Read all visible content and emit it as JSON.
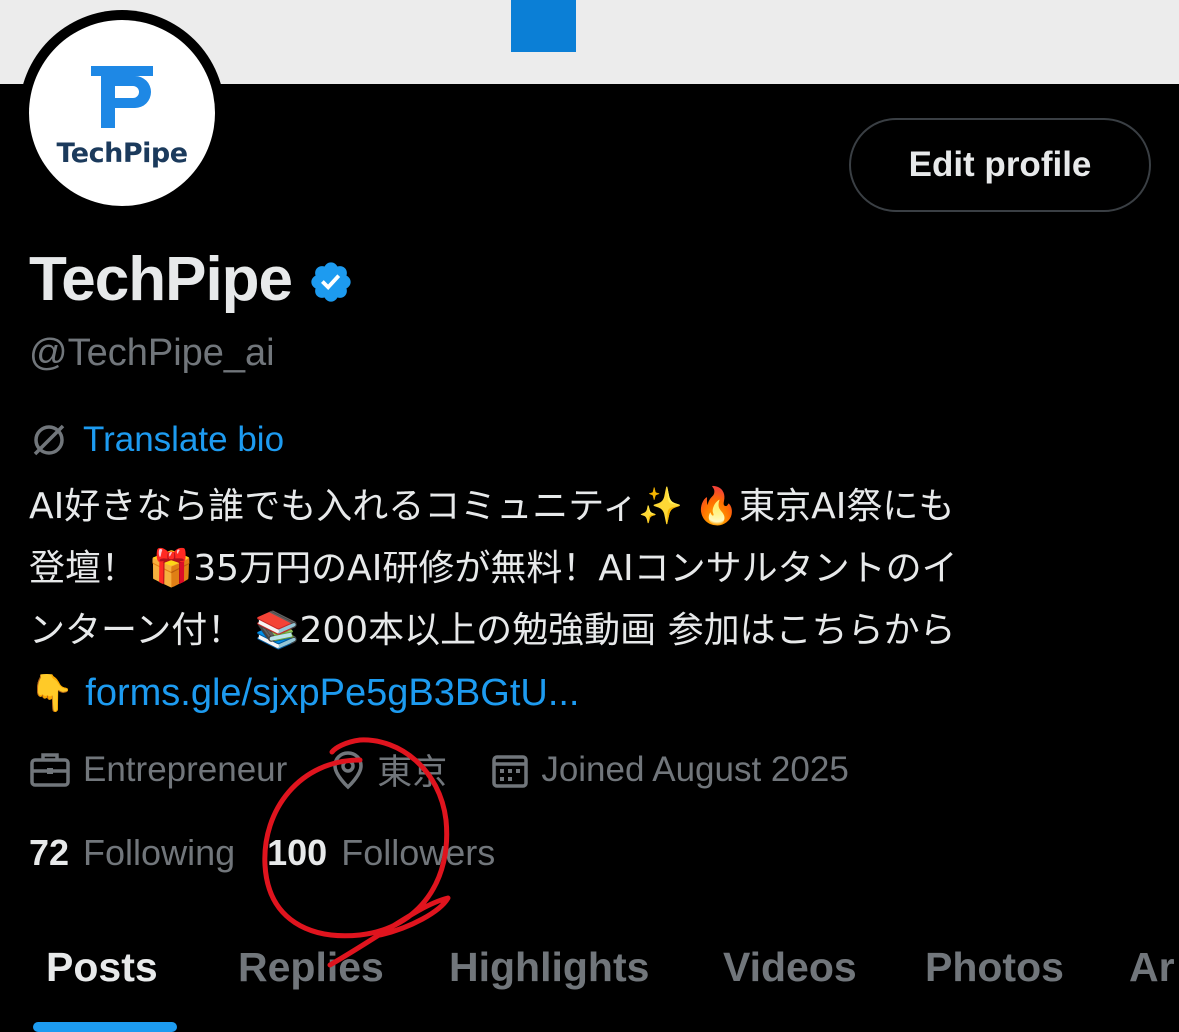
{
  "profile": {
    "avatar_text": "TechPipe",
    "name": "TechPipe",
    "handle": "@TechPipe_ai",
    "edit_label": "Edit profile",
    "translate_label": "Translate bio",
    "bio_lines": [
      "AI好きなら誰でも入れるコミュニティ✨ 🔥東京AI祭にも",
      "登壇！ 🎁35万円のAI研修が無料！AIコンサルタントのイ",
      "ンターン付！ 📚200本以上の勉強動画 参加はこちらから"
    ],
    "bio_pointer": "👇",
    "bio_link": "forms.gle/sjxpPe5gB3BGtU...",
    "profession": "Entrepreneur",
    "location": "東京",
    "joined": "Joined August 2025",
    "following_count": "72",
    "following_label": "Following",
    "followers_count": "100",
    "followers_label": "Followers"
  },
  "tabs": [
    {
      "label": "Posts",
      "active": true
    },
    {
      "label": "Replies"
    },
    {
      "label": "Highlights"
    },
    {
      "label": "Videos"
    },
    {
      "label": "Photos"
    },
    {
      "label": "Ar"
    }
  ],
  "colors": {
    "background": "#000000",
    "accent": "#1d9bf0",
    "muted": "#71767b",
    "annotation": "#e0141e"
  }
}
